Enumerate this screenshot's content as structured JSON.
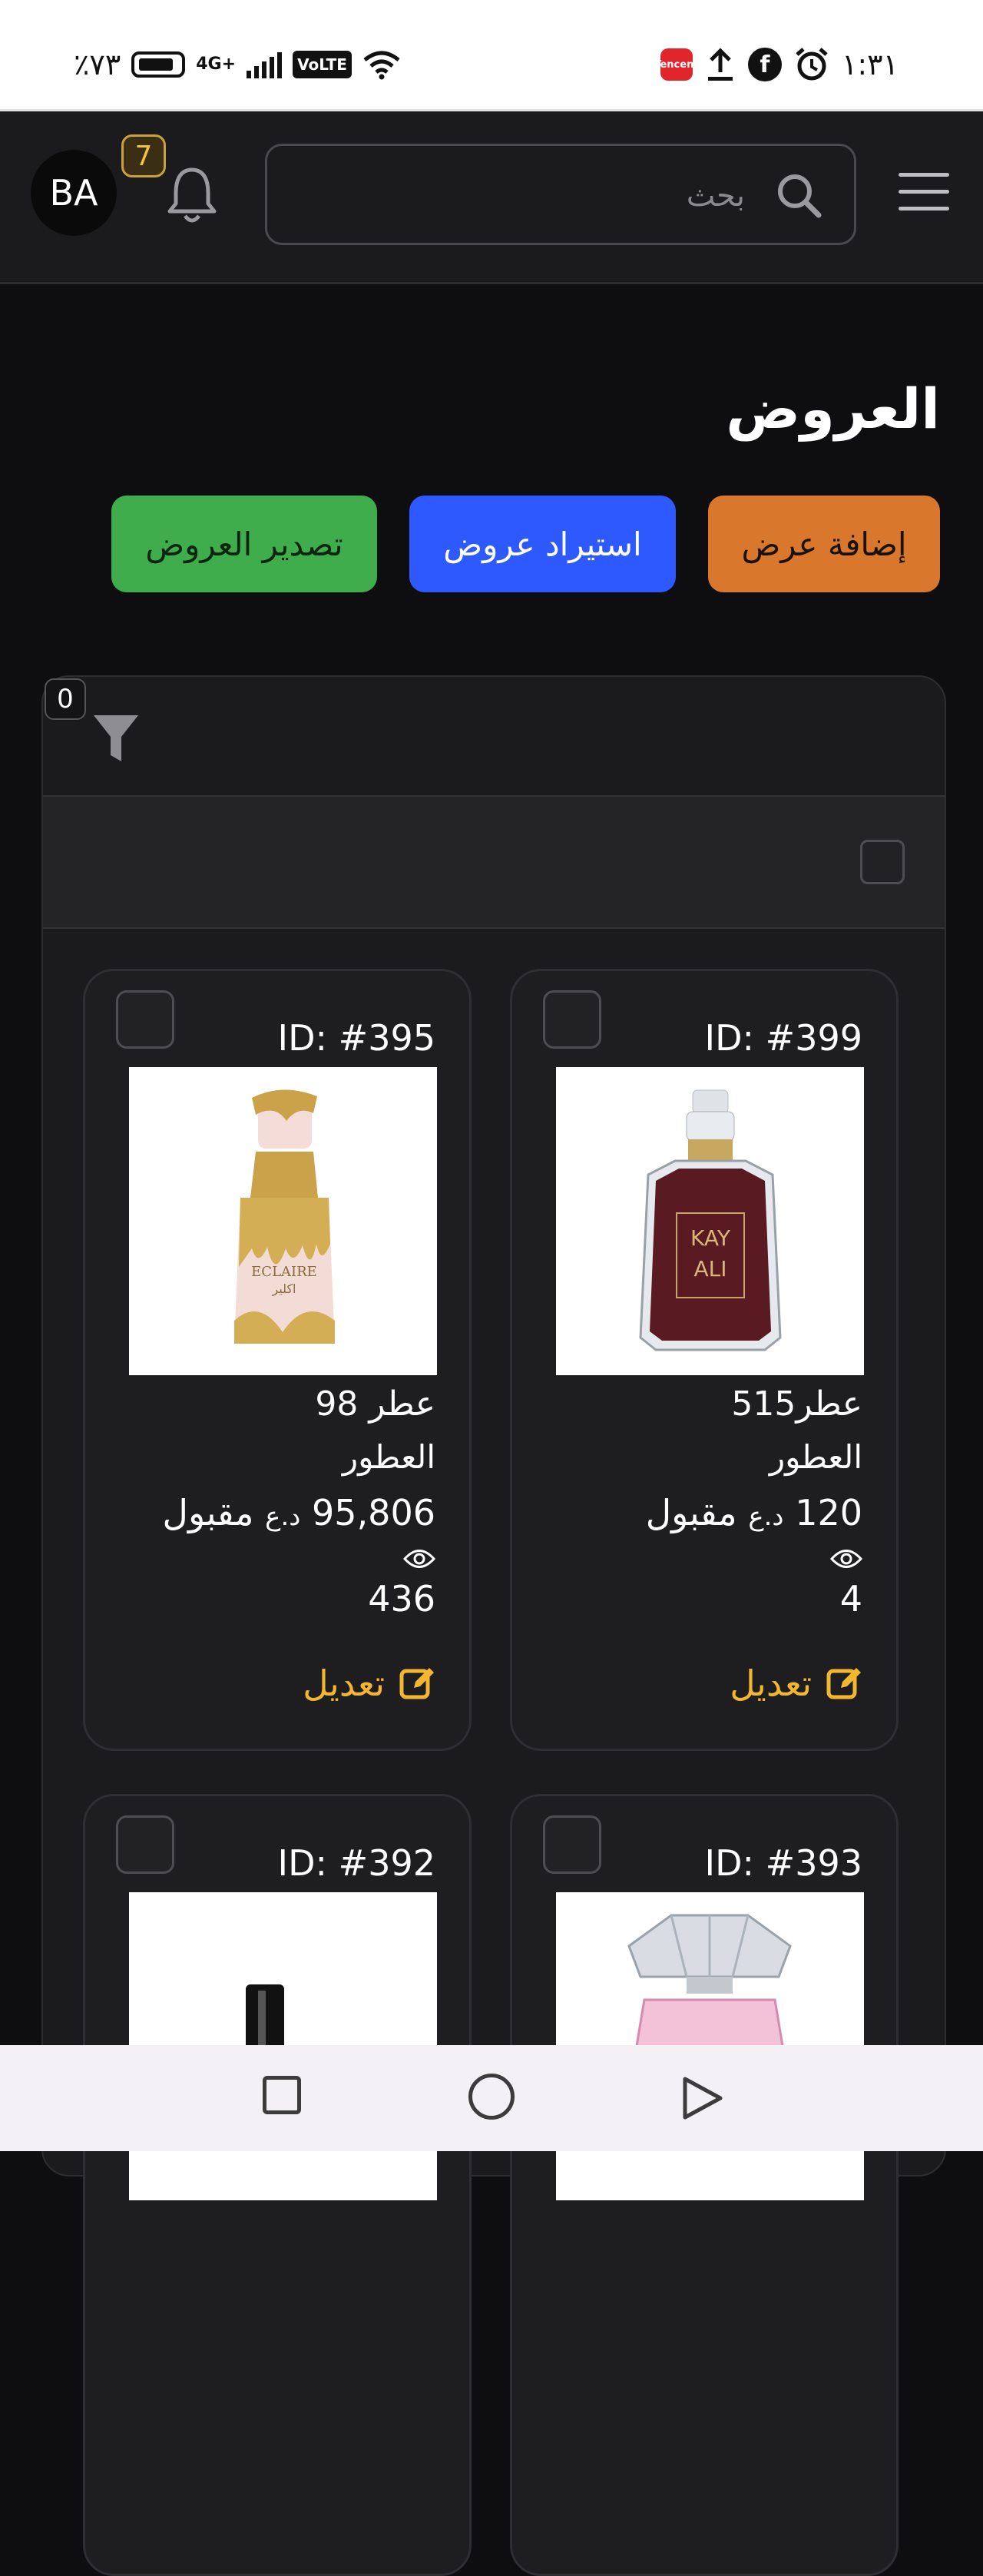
{
  "status_bar": {
    "time": "١:٣١",
    "battery": "٪٧٣",
    "network": "4G+",
    "volte": "VoLTE",
    "app_badge": "Tencent"
  },
  "header": {
    "avatar_initials": "BA",
    "notification_count": "7",
    "search_placeholder": "بحث"
  },
  "page": {
    "title": "العروض",
    "actions": {
      "add": "إضافة عرض",
      "import": "استيراد عروض",
      "export": "تصدير العروض"
    },
    "filter_count": "0"
  },
  "cards": [
    {
      "id": "ID: #399",
      "name": "عطر515",
      "category": "العطور",
      "price": "120",
      "currency": "د.ع",
      "status": "مقبول",
      "views": "4",
      "edit": "تعديل",
      "image": "perfume-kayali"
    },
    {
      "id": "ID: #395",
      "name": "عطر 98",
      "category": "العطور",
      "price": "95,806",
      "currency": "د.ع",
      "status": "مقبول",
      "views": "436",
      "edit": "تعديل",
      "image": "perfume-eclaire"
    },
    {
      "id": "ID: #393",
      "image": "perfume-crystal"
    },
    {
      "id": "ID: #392",
      "image": "perfume-black"
    }
  ],
  "colors": {
    "accent_edit": "#f2b630",
    "btn_add": "#d9782d",
    "btn_import": "#2d59ff",
    "btn_export": "#3fad4b"
  }
}
